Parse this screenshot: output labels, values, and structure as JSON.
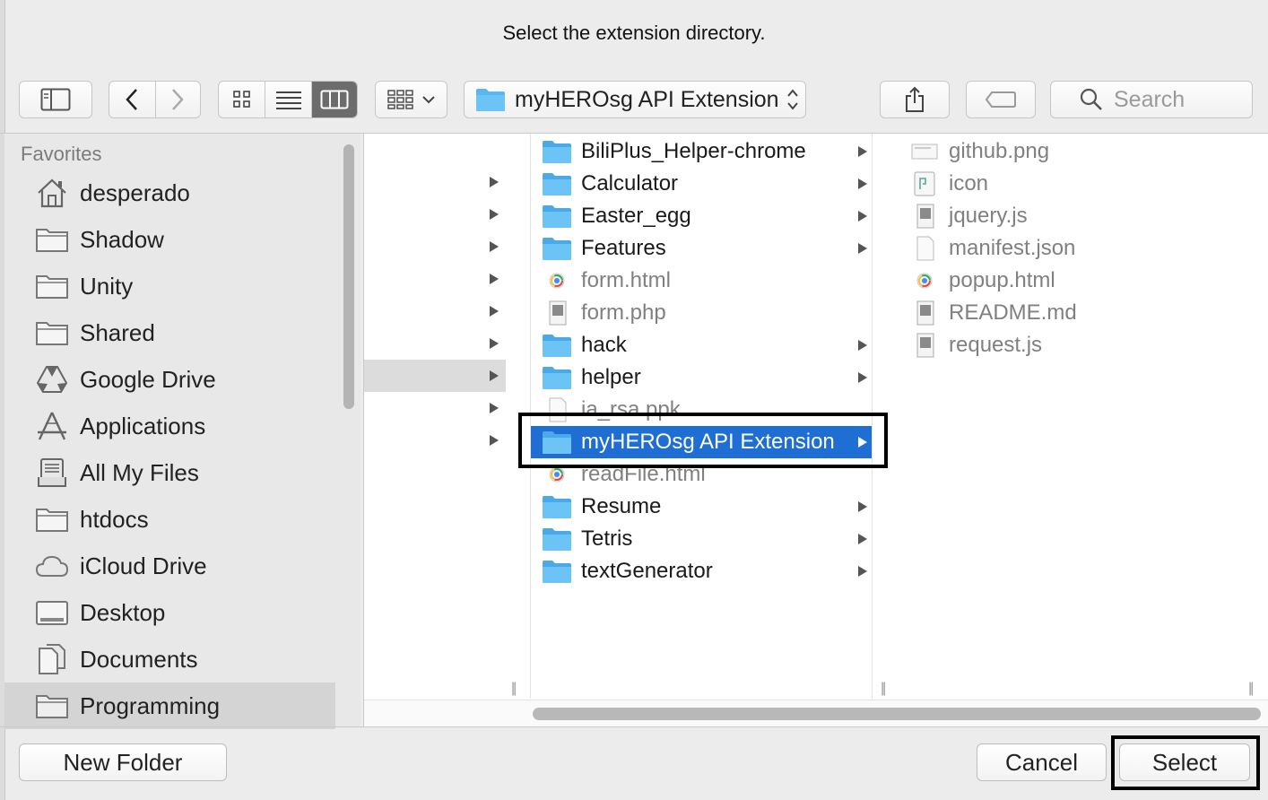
{
  "dialog": {
    "title": "Select the extension directory."
  },
  "toolbar": {
    "path_popup_label": "myHEROsg API Extension",
    "search_placeholder": "Search"
  },
  "sidebar": {
    "header": "Favorites",
    "items": [
      {
        "label": "desperado",
        "icon": "home-icon"
      },
      {
        "label": "Shadow",
        "icon": "folder-icon"
      },
      {
        "label": "Unity",
        "icon": "folder-icon"
      },
      {
        "label": "Shared",
        "icon": "folder-icon"
      },
      {
        "label": "Google Drive",
        "icon": "google-drive-icon"
      },
      {
        "label": "Applications",
        "icon": "applications-icon"
      },
      {
        "label": "All My Files",
        "icon": "all-my-files-icon"
      },
      {
        "label": "htdocs",
        "icon": "folder-icon"
      },
      {
        "label": "iCloud Drive",
        "icon": "cloud-icon"
      },
      {
        "label": "Desktop",
        "icon": "desktop-icon"
      },
      {
        "label": "Documents",
        "icon": "documents-icon"
      },
      {
        "label": "Programming",
        "icon": "folder-icon",
        "selected": true
      }
    ]
  },
  "column2": {
    "items": [
      {
        "name": "BiliPlus_Helper-chrome",
        "type": "folder"
      },
      {
        "name": "Calculator",
        "type": "folder"
      },
      {
        "name": "Easter_egg",
        "type": "folder"
      },
      {
        "name": "Features",
        "type": "folder"
      },
      {
        "name": "form.html",
        "type": "html"
      },
      {
        "name": "form.php",
        "type": "doc"
      },
      {
        "name": "hack",
        "type": "folder"
      },
      {
        "name": "helper",
        "type": "folder"
      },
      {
        "name": "ia_rsa.ppk",
        "type": "blank"
      },
      {
        "name": "myHEROsg API Extension",
        "type": "folder",
        "selected": true
      },
      {
        "name": "readFile.html",
        "type": "html"
      },
      {
        "name": "Resume",
        "type": "folder"
      },
      {
        "name": "Tetris",
        "type": "folder"
      },
      {
        "name": "textGenerator",
        "type": "folder"
      }
    ]
  },
  "column3": {
    "items": [
      {
        "name": "github.png",
        "type": "image"
      },
      {
        "name": "icon",
        "type": "image"
      },
      {
        "name": "jquery.js",
        "type": "doc"
      },
      {
        "name": "manifest.json",
        "type": "blank"
      },
      {
        "name": "popup.html",
        "type": "html"
      },
      {
        "name": "README.md",
        "type": "doc"
      },
      {
        "name": "request.js",
        "type": "doc"
      }
    ]
  },
  "buttons": {
    "new_folder": "New Folder",
    "cancel": "Cancel",
    "select": "Select"
  },
  "colors": {
    "selection": "#1f6ed4",
    "folder": "#5ab6f0"
  }
}
